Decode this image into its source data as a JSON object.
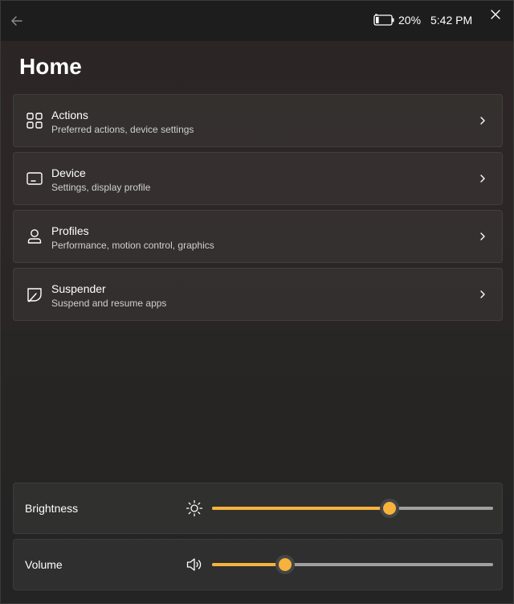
{
  "titlebar": {
    "battery_text": "20%",
    "battery_level": 0.2,
    "time": "5:42 PM"
  },
  "page": {
    "title": "Home"
  },
  "nav": [
    {
      "title": "Actions",
      "subtitle": "Preferred actions, device settings",
      "icon": "grid-icon"
    },
    {
      "title": "Device",
      "subtitle": "Settings, display profile",
      "icon": "display-icon"
    },
    {
      "title": "Profiles",
      "subtitle": "Performance, motion control, graphics",
      "icon": "person-icon"
    },
    {
      "title": "Suspender",
      "subtitle": "Suspend and resume apps",
      "icon": "leaf-icon"
    }
  ],
  "controls": {
    "brightness": {
      "label": "Brightness",
      "value": 63,
      "icon": "sun-icon"
    },
    "volume": {
      "label": "Volume",
      "value": 26,
      "icon": "speaker-icon"
    }
  },
  "colors": {
    "accent": "#f6b23c"
  }
}
